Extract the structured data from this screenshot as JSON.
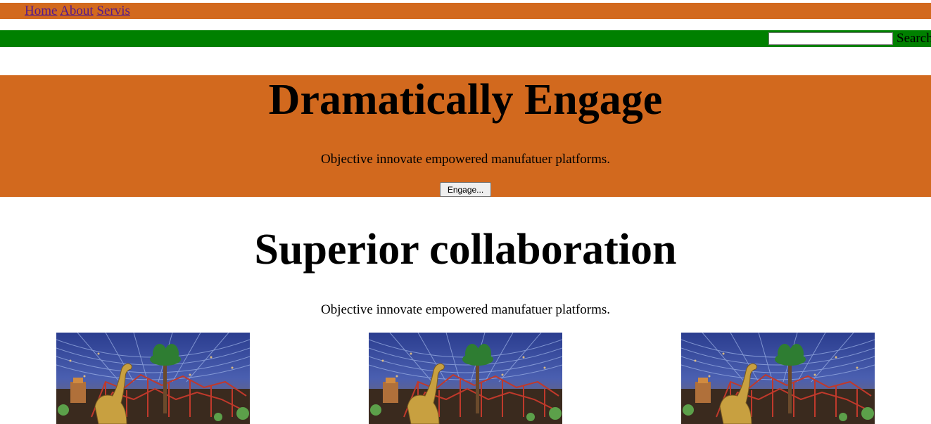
{
  "nav": {
    "links": [
      "Home",
      "About",
      "Servis"
    ]
  },
  "search": {
    "placeholder": "",
    "value": "",
    "label": "Search"
  },
  "hero": {
    "title": "Dramatically Engage",
    "subtitle": "Objective innovate empowered manufatuer platforms.",
    "button_label": "Engage..."
  },
  "section": {
    "title": "Superior collaboration",
    "subtitle": "Objective innovate empowered manufatuer platforms."
  },
  "gallery": {
    "images": [
      {
        "name": "indoor-theme-park-photo"
      },
      {
        "name": "indoor-theme-park-photo"
      },
      {
        "name": "indoor-theme-park-photo"
      }
    ]
  },
  "colors": {
    "nav_bar": "#d2691e",
    "search_bar": "#008000",
    "hero_background": "#d2691e",
    "link": "#551a8b"
  }
}
